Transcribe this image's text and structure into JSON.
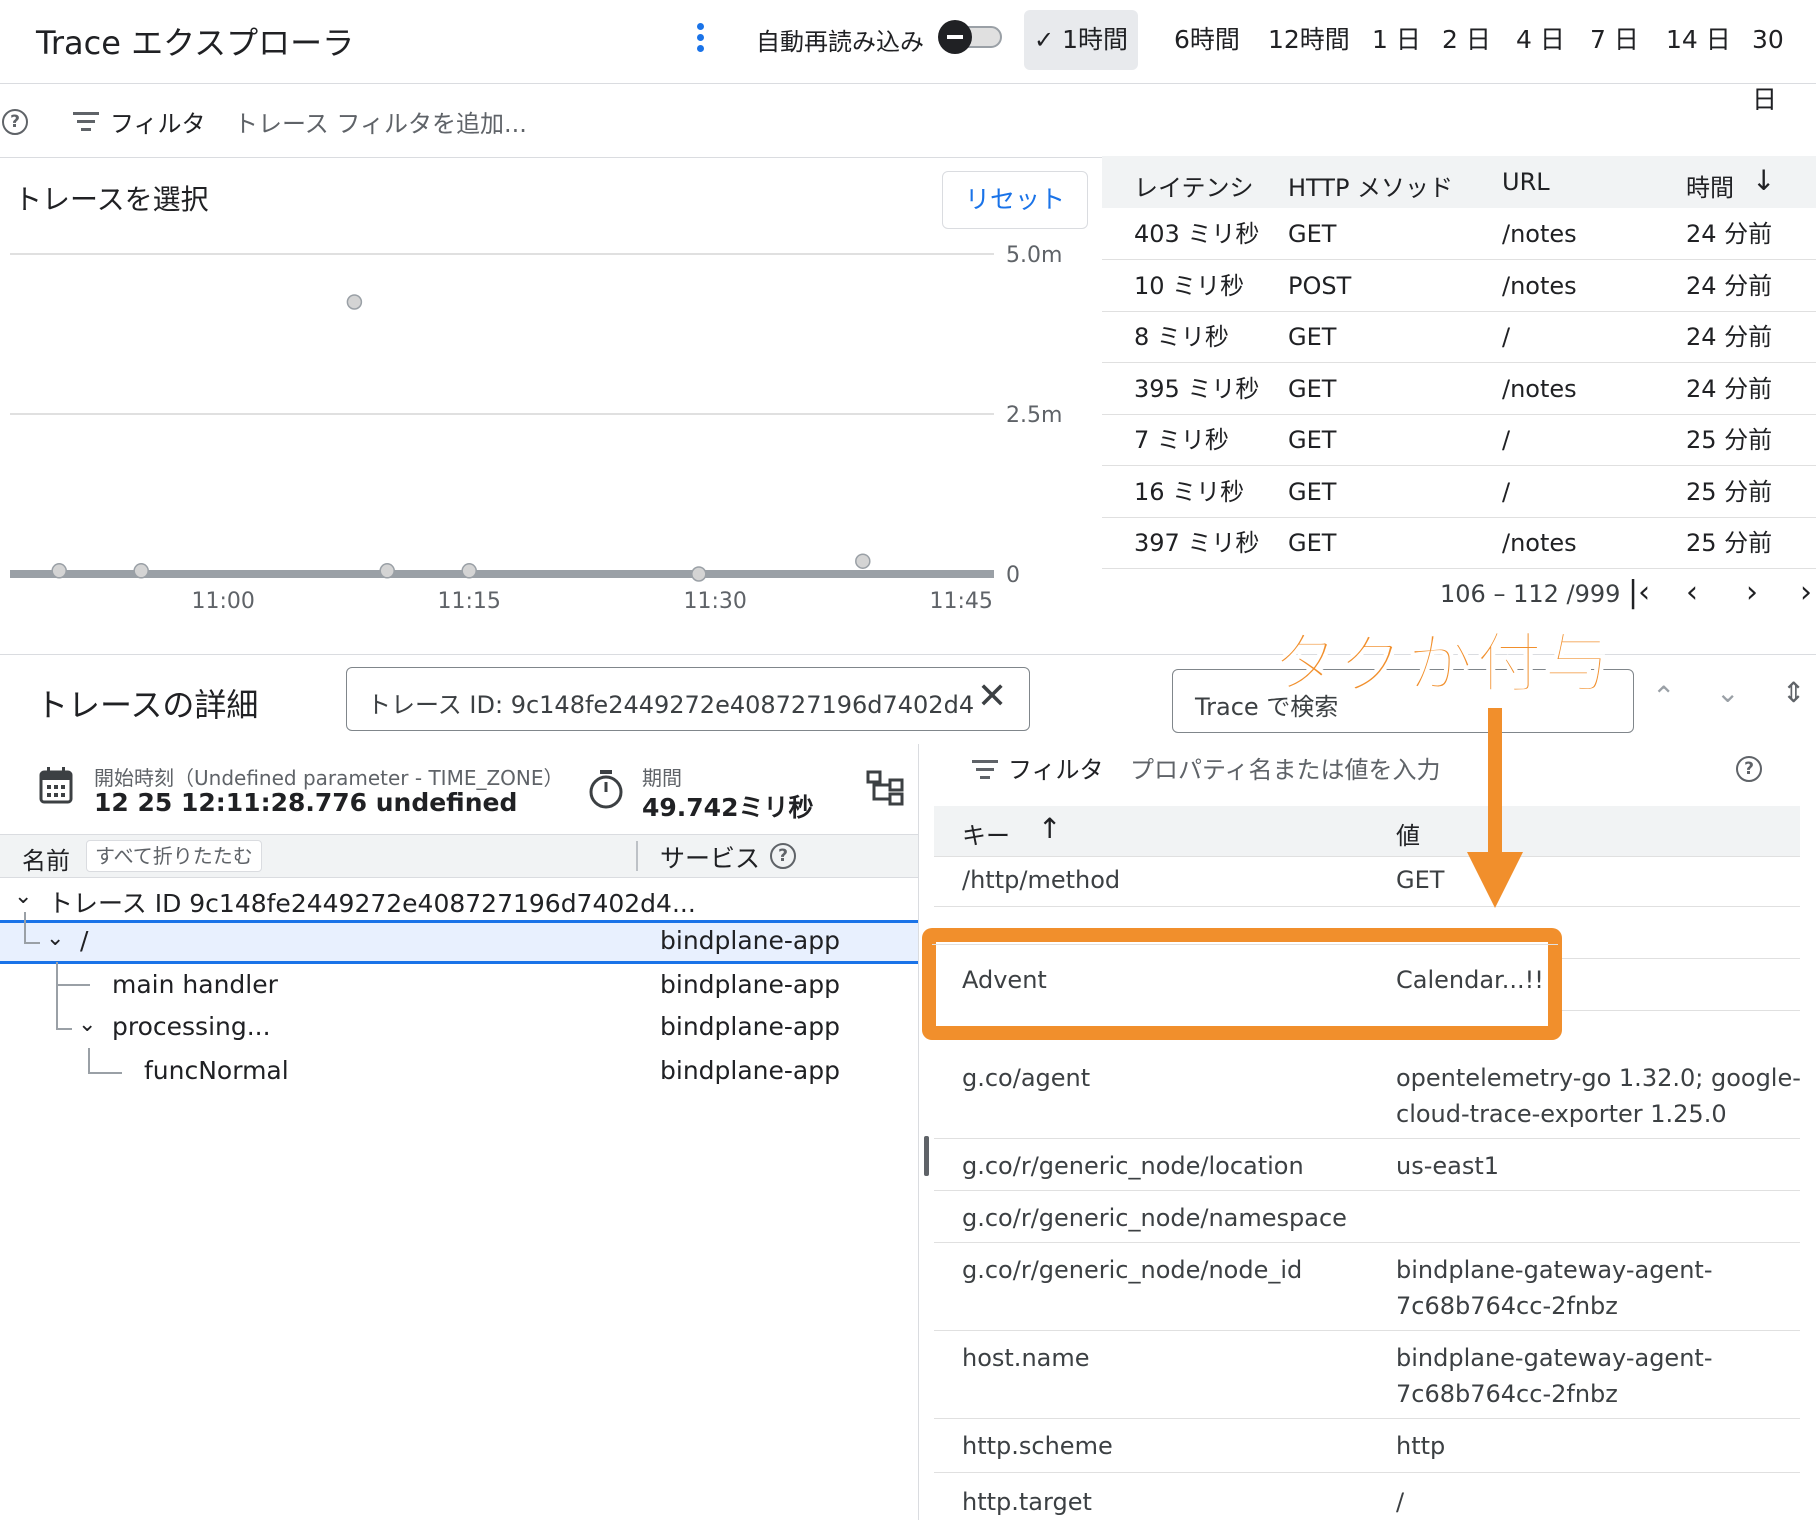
{
  "header": {
    "title": "Trace エクスプローラ",
    "auto_reload_label": "自動再読み込み",
    "time_ranges": [
      "1時間",
      "6時間",
      "12時間",
      "1 日",
      "2 日",
      "4 日",
      "7 日",
      "14 日",
      "30 日"
    ],
    "selected_range": "1時間"
  },
  "filter_bar": {
    "label": "フィルタ",
    "placeholder": "トレース フィルタを追加..."
  },
  "chart_panel": {
    "title": "トレースを選択",
    "reset_label": "リセット"
  },
  "chart_data": {
    "type": "scatter",
    "title": "",
    "xlabel": "",
    "ylabel": "",
    "x_ticks": [
      "11:00",
      "11:15",
      "11:30",
      "11:45"
    ],
    "y_ticks": [
      "0",
      "2.5m",
      "5.0m"
    ],
    "ylim": [
      0,
      5.0
    ],
    "xlim": [
      "10:47",
      "11:47"
    ],
    "grid": true,
    "series": [
      {
        "points": [
          {
            "x": "10:50",
            "y": 0.05
          },
          {
            "x": "10:55",
            "y": 0.05
          },
          {
            "x": "11:08",
            "y": 4.25
          },
          {
            "x": "11:10",
            "y": 0.05
          },
          {
            "x": "11:15",
            "y": 0.05
          },
          {
            "x": "11:29",
            "y": 0.0
          },
          {
            "x": "11:39",
            "y": 0.2
          }
        ]
      }
    ]
  },
  "trace_table": {
    "columns": [
      "レイテンシ",
      "HTTP メソッド",
      "URL",
      "時間"
    ],
    "rows": [
      [
        "403 ミリ秒",
        "GET",
        "/notes",
        "24 分前"
      ],
      [
        "10 ミリ秒",
        "POST",
        "/notes",
        "24 分前"
      ],
      [
        "8 ミリ秒",
        "GET",
        "/",
        "24 分前"
      ],
      [
        "395 ミリ秒",
        "GET",
        "/notes",
        "24 分前"
      ],
      [
        "7 ミリ秒",
        "GET",
        "/",
        "25 分前"
      ],
      [
        "16 ミリ秒",
        "GET",
        "/",
        "25 分前"
      ],
      [
        "397 ミリ秒",
        "GET",
        "/notes",
        "25 分前"
      ]
    ],
    "pagination": "106 – 112 /999"
  },
  "details": {
    "title": "トレースの詳細",
    "trace_id_value": "トレース ID: 9c148fe2449272e408727196d7402d4",
    "search_placeholder": "Trace で検索",
    "start_label": "開始時刻（Undefined parameter - TIME_ZONE）",
    "start_value": "12 25 12:11:28.776 undefined",
    "duration_label": "期間",
    "duration_value": "49.742ミリ秒"
  },
  "tree": {
    "name_col": "名前",
    "collapse_all": "すべて折りたたむ",
    "service_col": "サービス",
    "root": "トレース ID 9c148fe2449272e408727196d7402d4...",
    "spans": [
      {
        "name": "/",
        "service": "bindplane-app"
      },
      {
        "name": "main handler",
        "service": "bindplane-app"
      },
      {
        "name": "processing...",
        "service": "bindplane-app"
      },
      {
        "name": "funcNormal",
        "service": "bindplane-app"
      }
    ]
  },
  "attributes": {
    "filter_label": "フィルタ",
    "filter_placeholder": "プロパティ名または値を入力",
    "key_col": "キー",
    "value_col": "値",
    "rows": [
      {
        "key": "/http/method",
        "value": "GET"
      },
      {
        "key": "Advent",
        "value": "Calendar...!!"
      },
      {
        "key": "g.co/agent",
        "value": "opentelemetry-go 1.32.0; google-",
        "value2": "cloud-trace-exporter 1.25.0"
      },
      {
        "key": "g.co/r/generic_node/location",
        "value": "us-east1"
      },
      {
        "key": "g.co/r/generic_node/namespace",
        "value": ""
      },
      {
        "key": "g.co/r/generic_node/node_id",
        "value": "bindplane-gateway-agent-",
        "value2": "7c68b764cc-2fnbz"
      },
      {
        "key": "host.name",
        "value": "bindplane-gateway-agent-",
        "value2": "7c68b764cc-2fnbz"
      },
      {
        "key": "http.scheme",
        "value": "http"
      },
      {
        "key": "http.target",
        "value": "/"
      }
    ]
  },
  "annotation": {
    "text": "タグが付与",
    "color": "#f18f2c"
  },
  "colors": {
    "accent": "#1a73e8",
    "annotation": "#f18f2c"
  }
}
